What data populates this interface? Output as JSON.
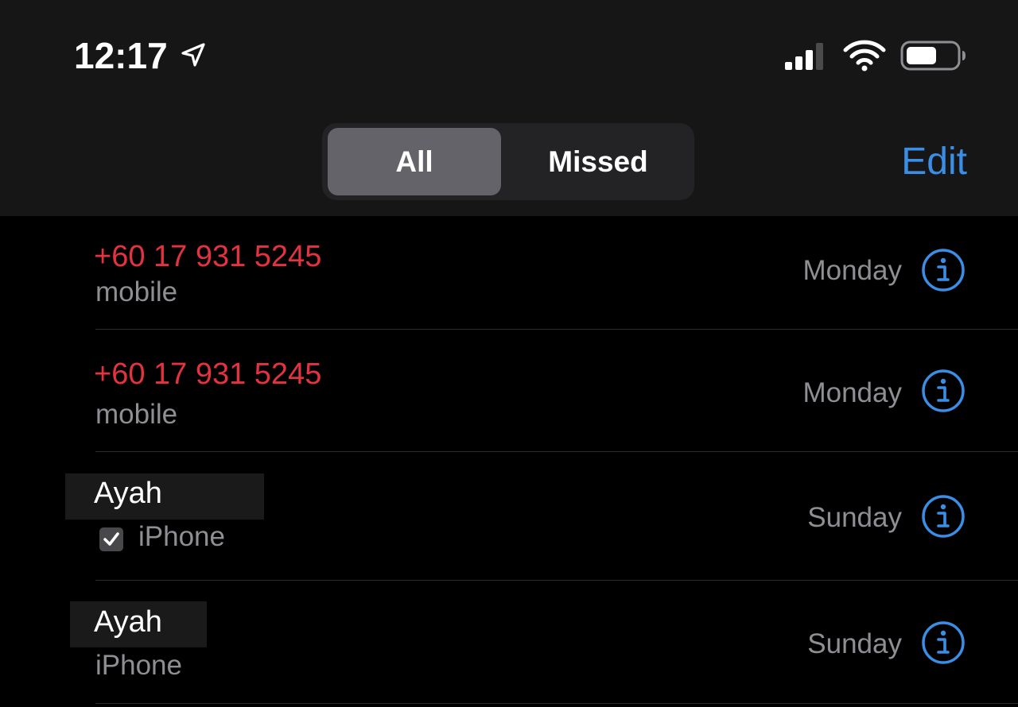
{
  "status_bar": {
    "time": "12:17",
    "location_icon": "location-arrow-icon",
    "signal_icon": "cellular-signal-icon",
    "wifi_icon": "wifi-icon",
    "battery_icon": "battery-icon"
  },
  "segmented": {
    "all_label": "All",
    "missed_label": "Missed",
    "selected": "All"
  },
  "nav": {
    "edit_label": "Edit"
  },
  "calls": [
    {
      "name": "+60 17 931 5245",
      "type": "mobile",
      "day": "Monday",
      "missed": true
    },
    {
      "name": "+60 17 931 5245",
      "type": "mobile",
      "day": "Monday",
      "missed": true
    },
    {
      "name": "Ayah",
      "type": "iPhone",
      "day": "Sunday",
      "missed": false,
      "checked": true
    },
    {
      "name": "Ayah",
      "type": "iPhone",
      "day": "Sunday",
      "missed": false
    }
  ],
  "colors": {
    "accent": "#3a8ee6",
    "missed": "#e5323f",
    "secondary_text": "#8e8e93",
    "background": "#000000",
    "header_background": "#161616"
  }
}
